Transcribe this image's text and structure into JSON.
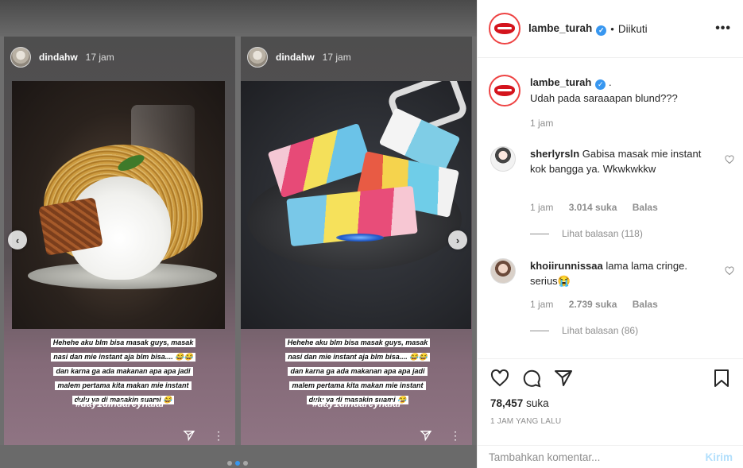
{
  "stories": [
    {
      "username": "dindahw",
      "time": "17 jam",
      "caption_lines": [
        "Hehehe aku blm bisa masak guys, masak",
        "nasi dan mie instant aja blm bisa.... 😂😂",
        "dan karna ga ada makanan apa apa jadi",
        "malem pertama kita makan mie instant",
        "dulu ya di masakin suami 😂"
      ],
      "hashtag": "#day1dindareyhalal"
    },
    {
      "username": "dindahw",
      "time": "17 jam",
      "caption_lines": [
        "Hehehe aku blm bisa masak guys, masak",
        "nasi dan mie instant aja blm bisa.... 😂😂",
        "dan karna ga ada makanan apa apa jadi",
        "malem pertama kita makan mie instant",
        "dulu ya di masakin suami 😂"
      ],
      "hashtag": "#day1dindareyhalal"
    }
  ],
  "carousel": {
    "prev_icon": "chevron-left-icon",
    "next_icon": "chevron-right-icon",
    "prev_glyph": "‹",
    "next_glyph": "›",
    "accent": "#3897f0"
  },
  "header": {
    "username": "lambe_turah",
    "separator": "•",
    "follow_label": "Diikuti",
    "more_glyph": "•••"
  },
  "caption": {
    "username": "lambe_turah",
    "suffix": ".",
    "text": "Udah pada saraaapan blund???",
    "time": "1 jam"
  },
  "comments": [
    {
      "username": "sherlyrsln",
      "text": "Gabisa masak mie instant kok bangga ya. Wkwkwkkw",
      "time": "1 jam",
      "likes": "3.014 suka",
      "reply_label": "Balas",
      "view_replies": "Lihat balasan (118)"
    },
    {
      "username": "khoiirunnissaa",
      "text": "lama lama cringe. serius😭",
      "time": "1 jam",
      "likes": "2.739 suka",
      "reply_label": "Balas",
      "view_replies": "Lihat balasan (86)"
    }
  ],
  "post": {
    "likes_count": "78,457",
    "likes_label": "suka",
    "time_ago": "1 JAM YANG LALU"
  },
  "add_comment": {
    "placeholder": "Tambahkan komentar...",
    "post_label": "Kirim"
  },
  "colors": {
    "verified": "#3897f0",
    "brand_red": "#d4141d",
    "post_btn": "#b2dffc"
  }
}
